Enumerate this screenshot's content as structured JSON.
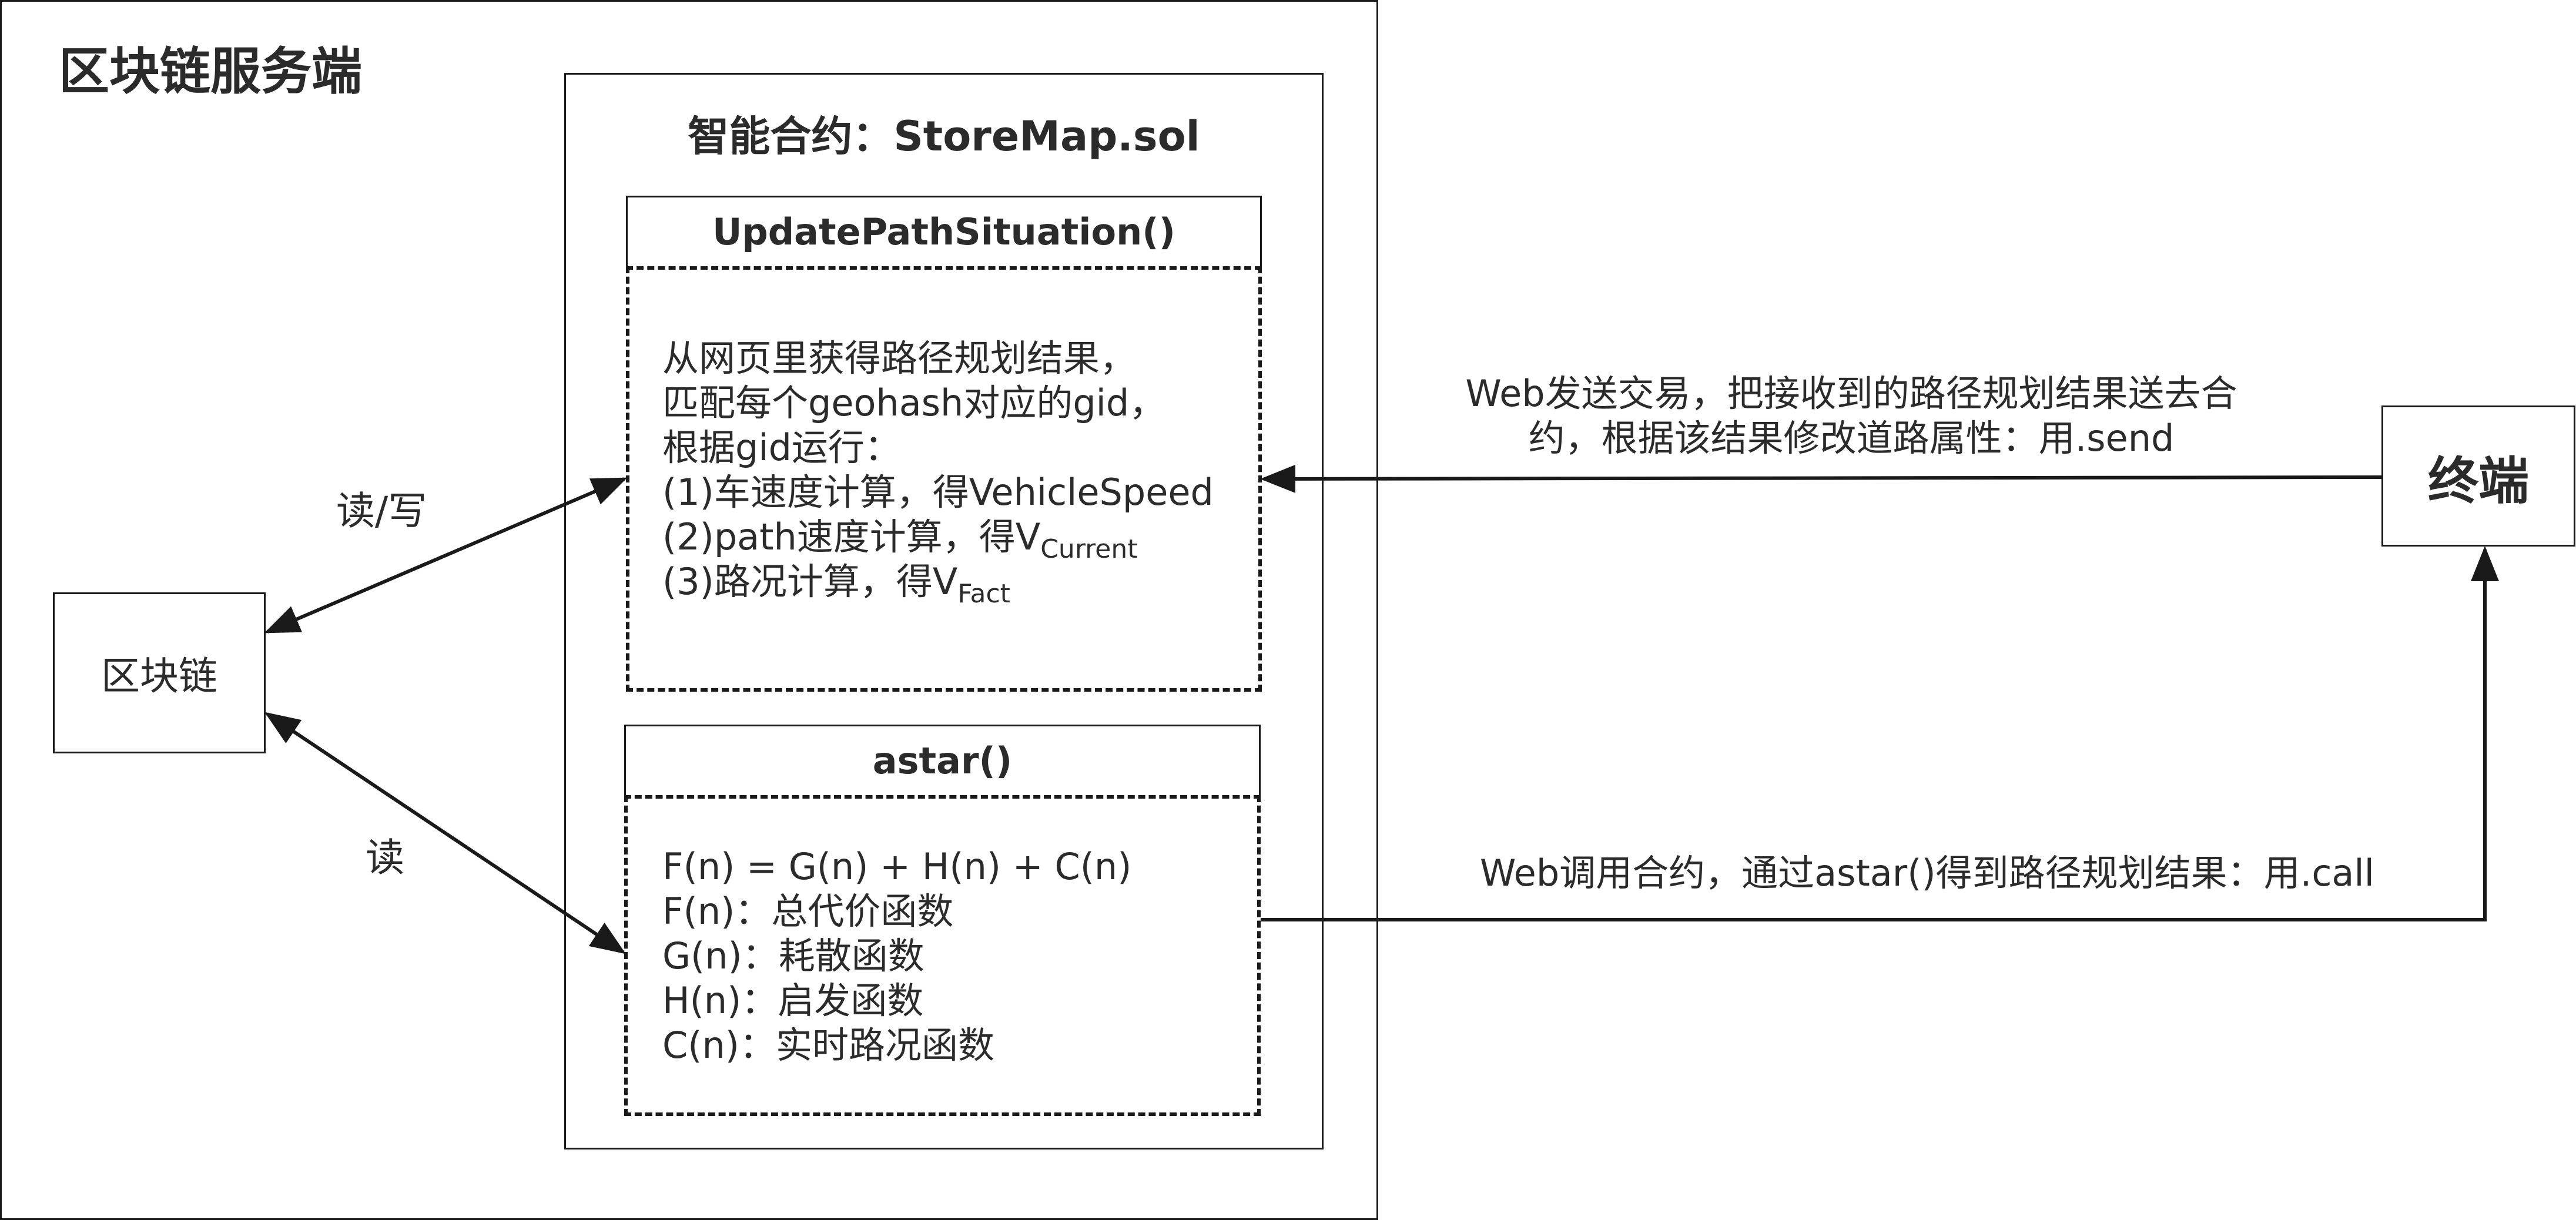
{
  "server": {
    "title": "区块链服务端"
  },
  "contract": {
    "title": "智能合约：StoreMap.sol"
  },
  "blockchain": {
    "label": "区块链"
  },
  "terminal": {
    "label": "终端"
  },
  "update_fn": {
    "title": "UpdatePathSituation()",
    "lines": [
      "从网页里获得路径规划结果，",
      "匹配每个geohash对应的gid，",
      "根据gid运行：",
      "(1)车速度计算，得VehicleSpeed"
    ],
    "line5_main": "(2)path速度计算，得V",
    "line5_sub": "Current",
    "line6_main": "(3)路况计算，得V",
    "line6_sub": "Fact"
  },
  "astar_fn": {
    "title": "astar()",
    "lines": [
      "F(n) = G(n) + H(n) + C(n)",
      "F(n)：总代价函数",
      "G(n)：耗散函数",
      "H(n)：启发函数",
      "C(n)：实时路况函数"
    ]
  },
  "edges": {
    "read_write": "读/写",
    "read": "读",
    "send_line1": "Web发送交易，把接收到的路径规划结果送去合",
    "send_line2": "约，根据该结果修改道路属性：用.send",
    "call": "Web调用合约，通过astar()得到路径规划结果：用.call"
  }
}
